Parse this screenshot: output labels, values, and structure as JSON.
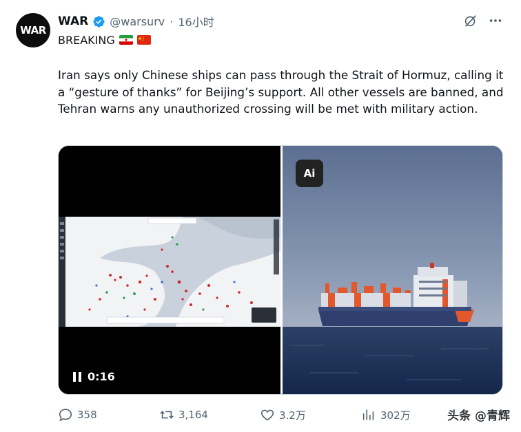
{
  "post": {
    "avatar_text": "WAR",
    "author_name": "WAR",
    "handle": "@warsurv",
    "separator": "·",
    "time": "16小时",
    "breaking": "BREAKING",
    "text": "Iran says only Chinese ships can pass through the Strait of Hormuz, calling it a “gesture of thanks” for Beijing’s support. All other vessels are banned, and Tehran warns any unauthorized crossing will be met with military action."
  },
  "media": {
    "video_time": "0:16",
    "ai_badge": "Ai"
  },
  "stats": {
    "replies": "358",
    "reposts": "3,164",
    "likes": "3.2万",
    "views": "302万"
  },
  "watermark": "头条 @青辉",
  "colors": {
    "text_primary": "#0f1419",
    "text_secondary": "#536471",
    "verified_blue": "#1d9bf0",
    "sky": "#6b7f9e",
    "sea": "#1e3357",
    "ship_hull": "#2f3f6e",
    "ship_orange": "#e2572b"
  },
  "icons": {
    "verified": "verified-badge-icon",
    "grok": "grok-icon",
    "more": "more-icon",
    "reply": "reply-icon",
    "repost": "repost-icon",
    "like": "like-icon",
    "views": "views-icon",
    "pause": "pause-icon"
  }
}
